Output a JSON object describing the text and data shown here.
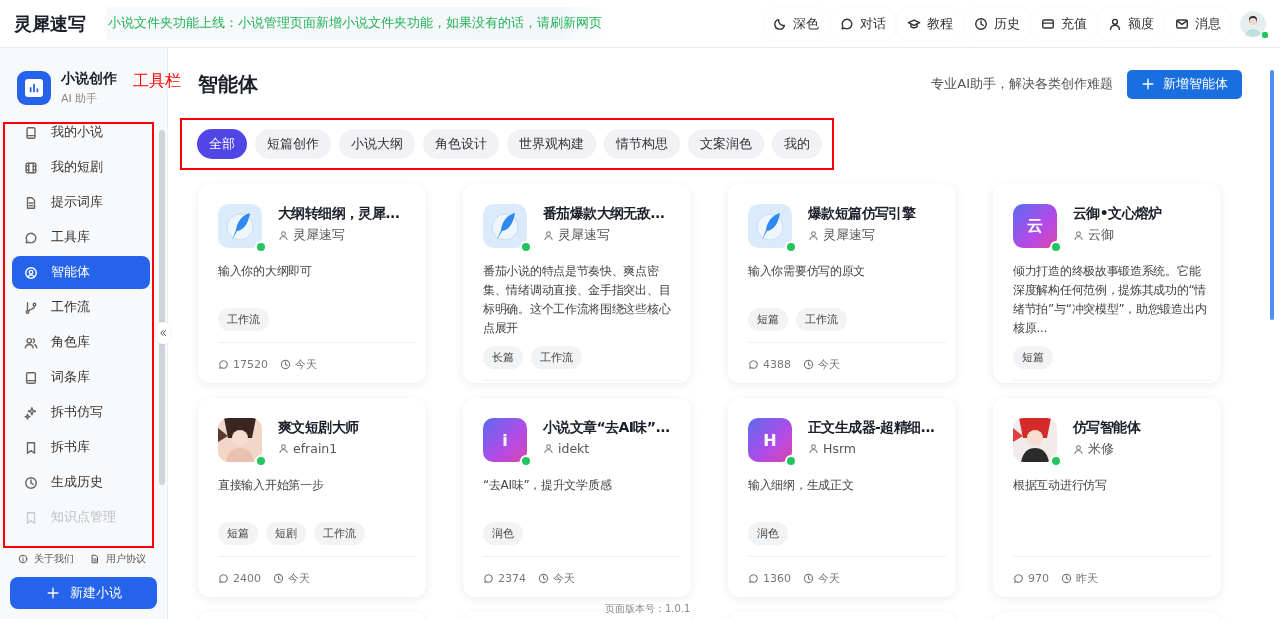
{
  "header": {
    "logo": "灵犀速写",
    "notice": "小说文件夹功能上线：小说管理页面新增小说文件夹功能，如果没有的话，请刷新网页",
    "nav": [
      {
        "label": "深色"
      },
      {
        "label": "对话"
      },
      {
        "label": "教程"
      },
      {
        "label": "历史"
      },
      {
        "label": "充值"
      },
      {
        "label": "额度"
      },
      {
        "label": "消息"
      }
    ],
    "user": {
      "online": true
    }
  },
  "sidebar": {
    "title": "小说创作",
    "subtitle": "AI 助手",
    "highlighted": true,
    "items": [
      {
        "label": "我的小说",
        "selected": false
      },
      {
        "label": "我的短剧",
        "selected": false
      },
      {
        "label": "提示词库",
        "selected": false
      },
      {
        "label": "工具库",
        "selected": false
      },
      {
        "label": "智能体",
        "selected": true
      },
      {
        "label": "工作流",
        "selected": false
      },
      {
        "label": "角色库",
        "selected": false
      },
      {
        "label": "词条库",
        "selected": false
      },
      {
        "label": "拆书仿写",
        "selected": false
      },
      {
        "label": "拆书库",
        "selected": false
      },
      {
        "label": "生成历史",
        "selected": false
      },
      {
        "label": "知识点管理",
        "selected": false
      }
    ],
    "footer_links": [
      "关于我们",
      "用户协议"
    ],
    "new_button": "新建小说"
  },
  "annotation_label": "工具栏",
  "page": {
    "title": "智能体",
    "subtitle": "专业AI助手，解决各类创作难题",
    "add_button": "新增智能体",
    "version": "页面版本号：1.0.1"
  },
  "tabs": {
    "highlighted": true,
    "items": [
      {
        "label": "全部",
        "selected": true
      },
      {
        "label": "短篇创作",
        "selected": false
      },
      {
        "label": "小说大纲",
        "selected": false
      },
      {
        "label": "角色设计",
        "selected": false
      },
      {
        "label": "世界观构建",
        "selected": false
      },
      {
        "label": "情节构思",
        "selected": false
      },
      {
        "label": "文案润色",
        "selected": false
      },
      {
        "label": "我的",
        "selected": false
      }
    ]
  },
  "cards": [
    {
      "avatar": {
        "kind": "logo"
      },
      "online": true,
      "title": "大纲转细纲，灵犀...",
      "author": "灵犀速写",
      "description": "输入你的大纲即可",
      "tags": [
        "工作流"
      ],
      "comments": "17520",
      "time": "今天"
    },
    {
      "avatar": {
        "kind": "logo"
      },
      "online": true,
      "title": "番茄爆款大纲无敌...",
      "author": "灵犀速写",
      "description": "番茄小说的特点是节奏快、爽点密集、情绪调动直接、金手指突出、目标明确。这个工作流将围绕这些核心点展开",
      "tags": [
        "长篇",
        "工作流"
      ]
    },
    {
      "avatar": {
        "kind": "logo"
      },
      "online": true,
      "title": "爆款短篇仿写引擎",
      "author": "灵犀速写",
      "description": "输入你需要仿写的原文",
      "tags": [
        "短篇",
        "工作流"
      ],
      "comments": "4388",
      "time": "今天"
    },
    {
      "avatar": {
        "kind": "letter",
        "letter": "云"
      },
      "online": true,
      "title": "云御•文心熔炉",
      "author": "云御",
      "description": "倾力打造的终极故事锻造系统。它能深度解构任何范例，提炼其成功的“情绪节拍”与“冲突模型”，助您锻造出内核原...",
      "tags": [
        "短篇"
      ]
    },
    {
      "online": true,
      "title": "爽文短剧大师",
      "author": "efrain1",
      "description": "直接输入开始第一步",
      "tags": [
        "短篇",
        "短剧",
        "工作流"
      ],
      "comments": "2400",
      "time": "今天"
    },
    {
      "avatar": {
        "kind": "letter",
        "letter": "i"
      },
      "online": true,
      "title": "小说文章“去AI味”...",
      "author": "idekt",
      "description": "“去AI味”，提升文学质感",
      "tags": [
        "润色"
      ],
      "comments": "2374",
      "time": "今天"
    },
    {
      "avatar": {
        "kind": "letter",
        "letter": "H"
      },
      "online": true,
      "title": "正文生成器-超精细...",
      "author": "Hsrm",
      "description": "输入细纲，生成正文",
      "tags": [
        "润色"
      ],
      "comments": "1360",
      "time": "今天"
    },
    {
      "online": true,
      "title": "仿写智能体",
      "author": "米修",
      "description": "根据互动进行仿写",
      "comments": "970",
      "time": "昨天"
    },
    {
      "avatar": {
        "kind": "empty"
      }
    },
    {
      "avatar": {
        "kind": "empty"
      }
    },
    {
      "avatar": {
        "kind": "empty"
      }
    },
    {
      "avatar": {
        "kind": "empty"
      }
    }
  ]
}
